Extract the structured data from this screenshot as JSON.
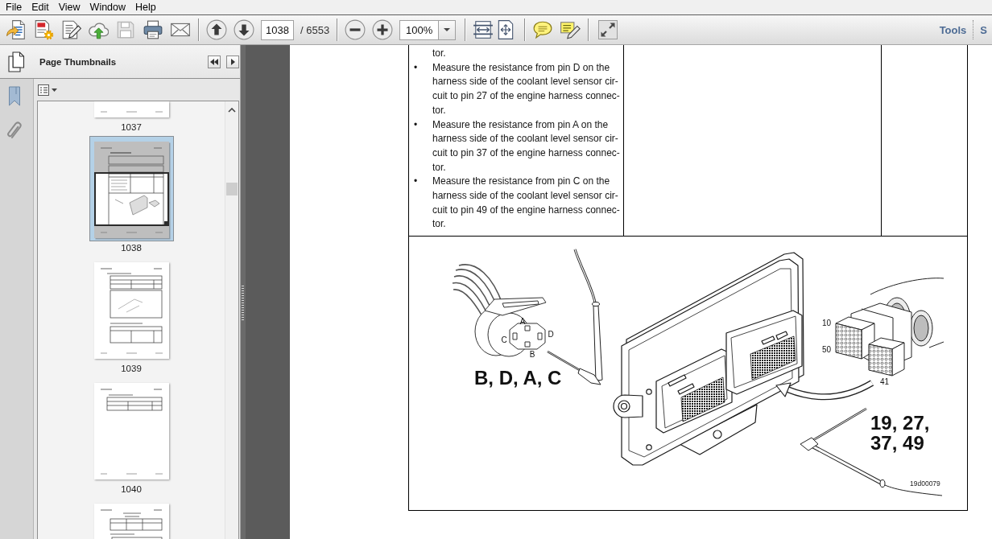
{
  "menu": [
    "File",
    "Edit",
    "View",
    "Window",
    "Help"
  ],
  "toolbar": {
    "save_disabled": true,
    "page_number": "1038",
    "page_count": "/ 6553",
    "zoom": "100%",
    "panes": [
      "Tools",
      "S"
    ]
  },
  "sidebar": {
    "title": "Page Thumbnails",
    "thumbnails": [
      {
        "label": "1037",
        "selected": false
      },
      {
        "label": "1038",
        "selected": true
      },
      {
        "label": "1039",
        "selected": false
      },
      {
        "label": "1040",
        "selected": false
      },
      {
        "selected": false
      }
    ]
  },
  "document": {
    "instructions": [
      {
        "lines": [
          "tor."
        ]
      },
      {
        "bullet": "•",
        "lines": [
          "Measure the resistance from pin D on the",
          "harness side of the coolant level sensor cir-",
          "cuit to pin 27 of the engine harness connec-",
          "tor."
        ]
      },
      {
        "bullet": "•",
        "lines": [
          "Measure the resistance from pin A on the",
          "harness side of the coolant level sensor cir-",
          "cuit to pin 37 of the engine harness connec-",
          "tor."
        ]
      },
      {
        "bullet": "•",
        "lines": [
          "Measure the resistance from pin C on the",
          "harness side of the coolant level sensor cir-",
          "cuit to pin 49 of the engine harness connec-",
          "tor."
        ]
      }
    ],
    "figure": {
      "pin_labels": [
        "A",
        "D",
        "C",
        "B"
      ],
      "probe_pins": "B, D, A, C",
      "module_pins": [
        "19, 27,",
        "37, 49"
      ],
      "connector_labels": [
        "10",
        "50",
        "41"
      ],
      "figure_id": "19d00079"
    }
  }
}
